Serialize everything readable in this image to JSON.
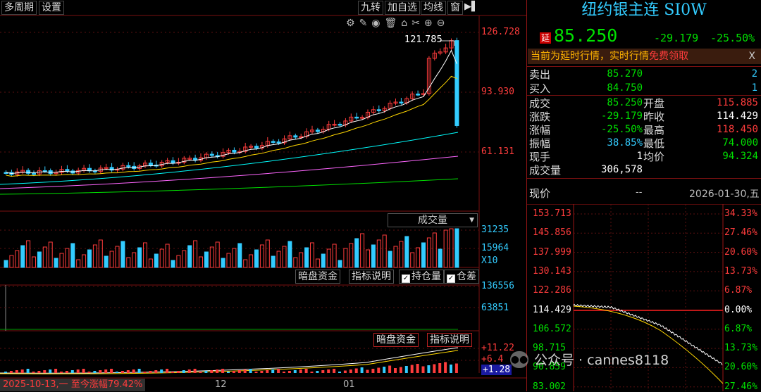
{
  "toolbar": {
    "period": "多周期",
    "settings": "设置",
    "nine_turn": "九转",
    "add_watch": "加自选",
    "ma_line": "均线",
    "window": "窗"
  },
  "kline": {
    "axis": [
      "126.728",
      "93.930",
      "61.131"
    ],
    "peak_label": "121.785",
    "colors": {
      "up": "#ff3c3c",
      "down": "#3cf",
      "ma5": "#fff",
      "ma10": "#ffd700",
      "ma20": "#00ffff",
      "ma60": "#ff66ff",
      "ma120": "#00e000"
    }
  },
  "volume": {
    "title": "成交量",
    "axis": [
      "31235",
      "15964",
      "X10"
    ]
  },
  "indicator1": {
    "dark_pool": "暗盘资金",
    "explain": "指标说明",
    "hold_position": "持仓量",
    "position_diff": "仓差",
    "axis": [
      "136556",
      "63851"
    ]
  },
  "indicator2": {
    "dark_pool": "暗盘资金",
    "explain": "指标说明",
    "axis": [
      "+11.22",
      "+6.4",
      "+1.28"
    ]
  },
  "bottom_bar": {
    "range_text": "2025-10-13,一 至今涨幅79.42%",
    "ticks": [
      "12",
      "01"
    ]
  },
  "quote": {
    "title": "纽约银主连 SI0W",
    "delay_badge": "延",
    "price": "85.250",
    "change": "-29.179",
    "change_pct": "-25.50%",
    "notice": "当前为延时行情，实时行情",
    "notice_link": "免费领取",
    "close": "X",
    "sell_label": "卖出",
    "sell_price": "85.270",
    "sell_qty": "2",
    "buy_label": "买入",
    "buy_price": "84.750",
    "buy_qty": "1",
    "rows": [
      {
        "l1": "成交",
        "v1": "85.250",
        "c1": "green",
        "l2": "开盘",
        "v2": "115.885",
        "c2": "red"
      },
      {
        "l1": "涨跌",
        "v1": "-29.179",
        "c1": "green",
        "l2": "昨收",
        "v2": "114.429",
        "c2": "white"
      },
      {
        "l1": "涨幅",
        "v1": "-25.50%",
        "c1": "green",
        "l2": "最高",
        "v2": "118.450",
        "c2": "red"
      },
      {
        "l1": "振幅",
        "v1": "38.85%",
        "c1": "cyan",
        "l2": "最低",
        "v2": "74.000",
        "c2": "green"
      },
      {
        "l1": "现手",
        "v1": "1",
        "c1": "white",
        "l2": "均价",
        "v2": "94.324",
        "c2": "green"
      }
    ],
    "volume_label": "成交量",
    "volume_value": "306,578"
  },
  "intraday": {
    "label": "现价",
    "dash": "--",
    "date": "2026-01-30,五",
    "left_axis": [
      "153.713",
      "145.856",
      "137.999",
      "130.143",
      "122.286",
      "114.429",
      "106.572",
      "98.715",
      "90.859",
      "83.002"
    ],
    "right_axis": [
      "34.33%",
      "27.46%",
      "20.60%",
      "13.73%",
      "6.87%",
      "0.00%",
      "6.87%",
      "13.73%",
      "20.60%",
      "27.46%"
    ]
  },
  "watermark": "公众号 · cannes8118"
}
